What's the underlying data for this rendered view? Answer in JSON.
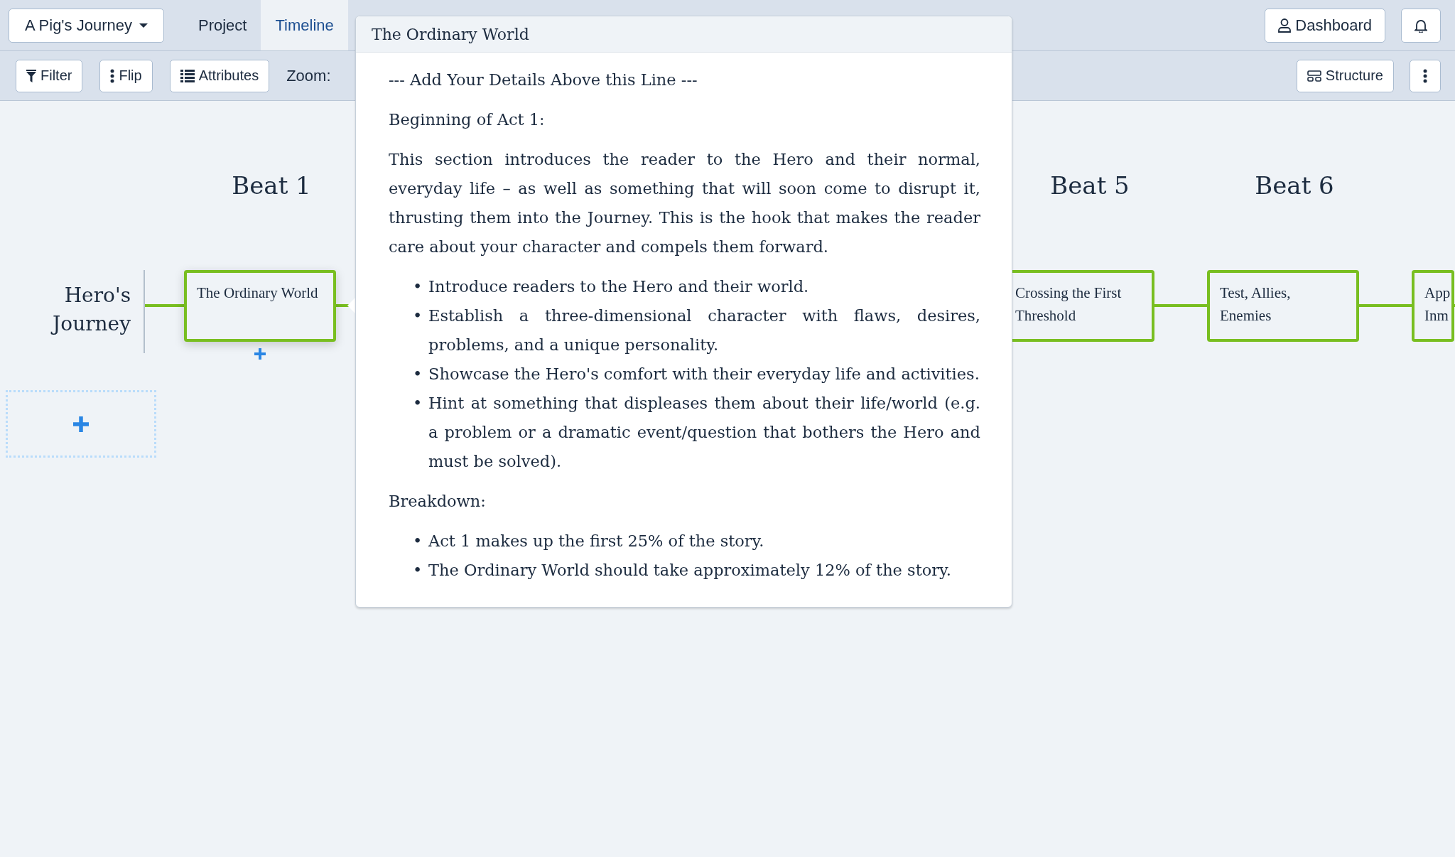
{
  "project_menu": {
    "label": "A Pig's Journey"
  },
  "tabs": [
    {
      "label": "Project",
      "selected": false
    },
    {
      "label": "Timeline",
      "selected": true
    }
  ],
  "header_buttons": [
    {
      "kind": "dashboard",
      "label": "Dashboard"
    },
    {
      "kind": "notifications"
    }
  ],
  "toolbar": {
    "buttons": [
      {
        "kind": "filter",
        "label": "Filter"
      },
      {
        "kind": "flip",
        "label": "Flip"
      },
      {
        "kind": "attributes",
        "label": "Attributes"
      }
    ],
    "zoom_label": "Zoom:",
    "right_buttons": [
      {
        "kind": "structure",
        "label": "Structure"
      },
      {
        "kind": "more"
      }
    ]
  },
  "timeline": {
    "beats_before_popover": [
      {
        "title": "Beat 1"
      }
    ],
    "beats_after_popover": [
      {
        "title": "Beat 5"
      },
      {
        "title": "Beat 6"
      }
    ],
    "lanes": [
      {
        "title": "Hero's Journey",
        "cards_before_popover": [
          {
            "title": "The Ordinary World",
            "selected": true
          }
        ],
        "cards_after_popover": [
          {
            "title": "Crossing the First Threshold",
            "selected": false
          },
          {
            "title": "Test, Allies, Enemies",
            "selected": false
          },
          {
            "title": "App Inm",
            "selected": false
          }
        ]
      }
    ]
  },
  "popover": {
    "title": "The Ordinary World",
    "blocks": [
      {
        "kind": "paragraph",
        "text": "--- Add Your Details Above this Line ---"
      },
      {
        "kind": "paragraph",
        "text": "Beginning of Act 1:"
      },
      {
        "kind": "justified",
        "text": "This section introduces the reader to the Hero and their normal, everyday life – as well as something that will soon come to disrupt it, thrusting them into the Journey. This is the hook that makes the reader care about your character and compels them forward."
      },
      {
        "kind": "list",
        "marker": "•",
        "items": [
          "Introduce readers to the Hero and their world.",
          "Establish a three-dimensional character with flaws, desires, problems, and a unique personality.",
          "Showcase the Hero's comfort with their everyday life and activities.",
          "Hint at something that displeases them about their life/world (e.g. a problem or a dramatic event/question that bothers the Hero and must be solved)."
        ]
      },
      {
        "kind": "paragraph",
        "text": "Breakdown:"
      },
      {
        "kind": "list",
        "marker": "•",
        "items": [
          "Act 1 makes up the first 25% of the story.",
          "The Ordinary World should take approximately 12% of the story."
        ]
      }
    ]
  }
}
